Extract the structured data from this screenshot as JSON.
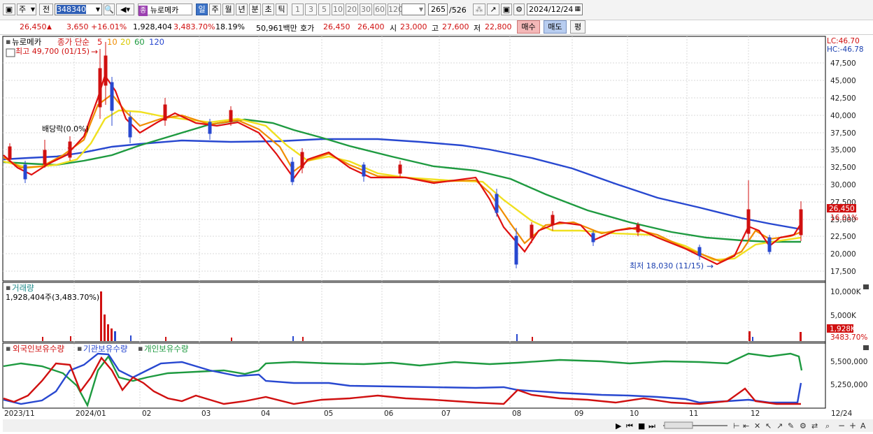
{
  "toolbar": {
    "market_label": "주",
    "type_label": "전",
    "stock_code": "348340",
    "stock_badge": "종",
    "stock_name": "뉴로메카",
    "periods": [
      "일",
      "주",
      "월",
      "년",
      "분",
      "초",
      "틱"
    ],
    "active_period": "일",
    "intervals": [
      "1",
      "3",
      "5",
      "10",
      "20",
      "30",
      "60",
      "120"
    ],
    "count_display": "265",
    "count_total": "/526",
    "date": "2024/12/24"
  },
  "quote": {
    "price": "26,450",
    "change": "3,650",
    "change_pct": "+16.01%",
    "volume": "1,928,404",
    "volume_ratio": "3,483.70%",
    "turnover": "18.19%",
    "trade_value": "50,961백만",
    "bid_label": "호가",
    "ask_price": "26,450",
    "bid_price": "26,400",
    "open_label": "시",
    "open": "23,000",
    "high_label": "고",
    "high": "27,600",
    "low_label": "저",
    "low": "22,800",
    "buy_label": "매수",
    "sell_label": "매도",
    "eval_label": "평"
  },
  "price_panel": {
    "title": "뉴로메카",
    "ma_label": "종가 단순",
    "ma_periods": [
      "5",
      "10",
      "20",
      "60",
      "120"
    ],
    "ma_colors": [
      "#e01010",
      "#f08c00",
      "#f0e020",
      "#1e9a40",
      "#2848d0"
    ],
    "high_note": "최고 49,700 (01/15)",
    "low_note": "최저 18,030 (11/15)",
    "dividend_note": "배당락(0.0%)",
    "lc": "LC:46.70",
    "hc": "HC:-46.78",
    "price_tag": "26,450",
    "pct_tag": "16.01%",
    "y_ticks": [
      "47,500",
      "45,000",
      "42,500",
      "40,000",
      "37,500",
      "35,000",
      "32,500",
      "30,000",
      "27,500",
      "25,000",
      "22,500",
      "20,000",
      "17,500"
    ]
  },
  "volume_panel": {
    "title": "거래량",
    "value_note": "1,928,404주(3,483.70%)",
    "y_ticks": [
      "10,000K",
      "5,000K"
    ],
    "tag_value": "1,928K",
    "tag_pct": "3483.70%"
  },
  "holding_panel": {
    "series": [
      "외국인보유수량",
      "기관보유수량",
      "개인보유수량"
    ],
    "colors": [
      "#d01010",
      "#2848d0",
      "#1e9a40"
    ],
    "y_ticks": [
      "5,500,000",
      "5,250,000"
    ]
  },
  "x_axis": {
    "labels": [
      "2023/11",
      "2024/01",
      "02",
      "03",
      "04",
      "05",
      "06",
      "07",
      "08",
      "09",
      "10",
      "11",
      "12"
    ],
    "right_label": "12/24"
  }
}
